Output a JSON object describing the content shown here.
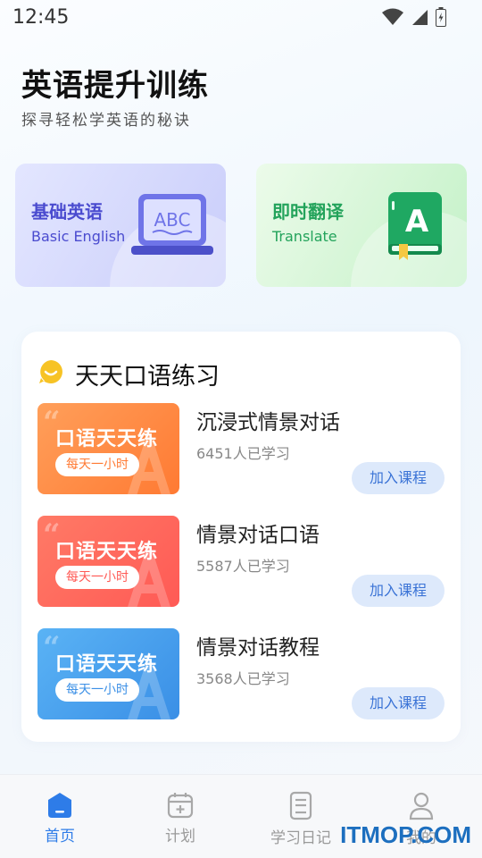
{
  "status_bar": {
    "time": "12:45",
    "icons": [
      "wifi-icon",
      "signal-icon",
      "battery-icon"
    ]
  },
  "header": {
    "title": "英语提升训练",
    "subtitle": "探寻轻松学英语的秘诀"
  },
  "feature_cards": [
    {
      "title": "基础英语",
      "subtitle": "Basic English",
      "icon": "abc-laptop-icon",
      "color": "#4a4bcf"
    },
    {
      "title": "即时翻译",
      "subtitle": "Translate",
      "icon": "translate-book-icon",
      "color": "#23a35b"
    }
  ],
  "section": {
    "title": "天天口语练习",
    "icon": "speech-bubble-icon",
    "courses": [
      {
        "thumb_title": "口语天天练",
        "thumb_tag": "每天一小时",
        "title": "沉浸式情景对话",
        "count": "6451人已学习",
        "button": "加入课程",
        "theme": "orange"
      },
      {
        "thumb_title": "口语天天练",
        "thumb_tag": "每天一小时",
        "title": "情景对话口语",
        "count": "5587人已学习",
        "button": "加入课程",
        "theme": "red"
      },
      {
        "thumb_title": "口语天天练",
        "thumb_tag": "每天一小时",
        "title": "情景对话教程",
        "count": "3568人已学习",
        "button": "加入课程",
        "theme": "blue"
      }
    ]
  },
  "bottom_nav": {
    "items": [
      {
        "label": "首页",
        "icon": "home-icon",
        "active": true
      },
      {
        "label": "计划",
        "icon": "calendar-plus-icon",
        "active": false
      },
      {
        "label": "学习日记",
        "icon": "notebook-icon",
        "active": false
      },
      {
        "label": "我的",
        "icon": "user-icon",
        "active": false
      }
    ]
  },
  "watermark": "ITMOP.COM",
  "colors": {
    "accent": "#2e7ce8",
    "button_bg": "#dde9fb",
    "button_text": "#3a73d6"
  }
}
